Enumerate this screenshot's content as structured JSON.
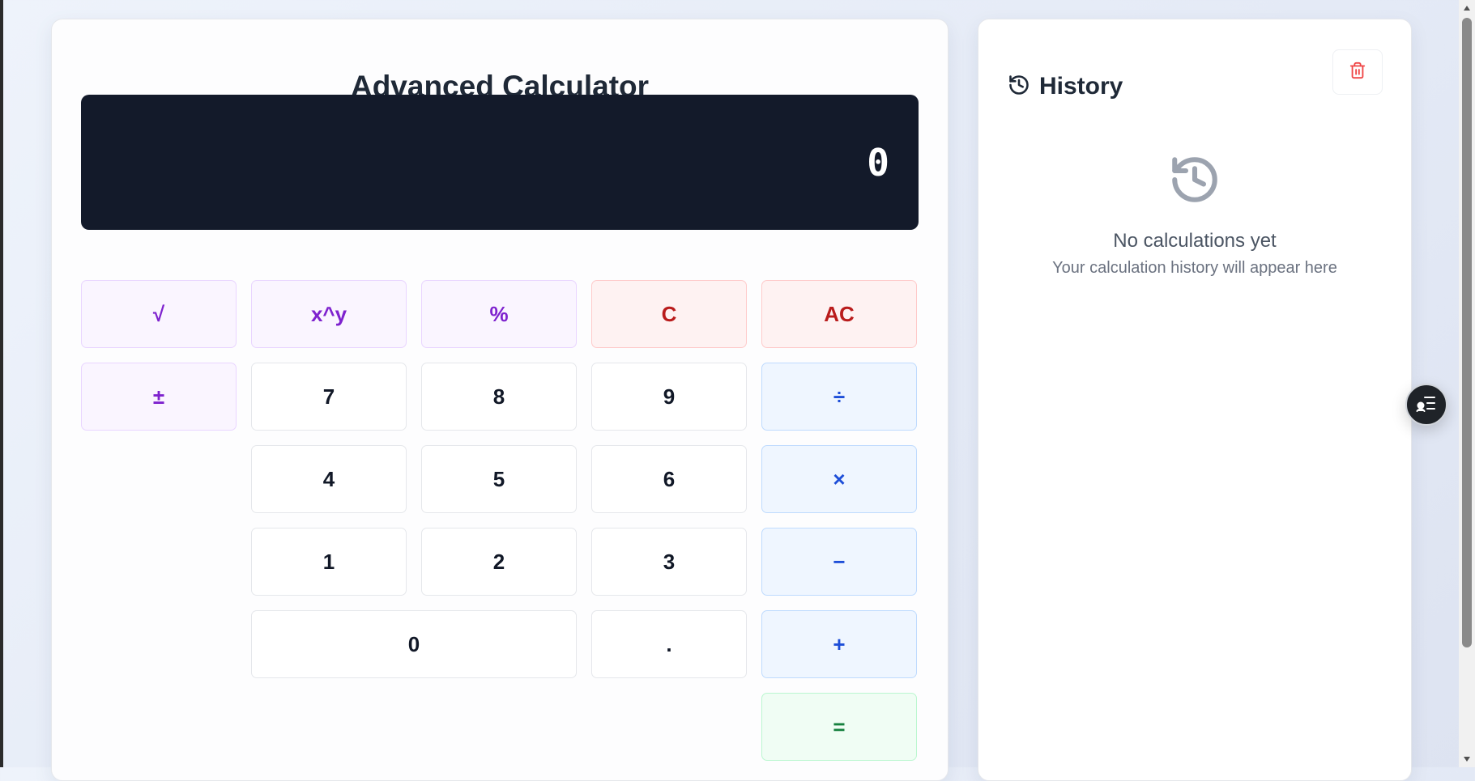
{
  "calculator": {
    "title": "Advanced Calculator",
    "display_value": "0",
    "keys": {
      "sqrt": "√",
      "power": "x^y",
      "percent": "%",
      "clear": "C",
      "all_clear": "AC",
      "negate": "±",
      "seven": "7",
      "eight": "8",
      "nine": "9",
      "divide": "÷",
      "four": "4",
      "five": "5",
      "six": "6",
      "multiply": "×",
      "one": "1",
      "two": "2",
      "three": "3",
      "subtract": "−",
      "zero": "0",
      "decimal": ".",
      "add": "+",
      "equals": "="
    }
  },
  "history": {
    "title": "History",
    "empty_title": "No calculations yet",
    "empty_subtitle": "Your calculation history will appear here"
  },
  "icons": {
    "history": "history-icon",
    "trash": "trash-icon",
    "empty_history": "history-icon",
    "fab": "list-settings-icon"
  },
  "colors": {
    "display_bg": "#131a2a",
    "function_key": "#7e22ce",
    "clear_key": "#b91c1c",
    "operator_key": "#1d4ed8",
    "equals_key": "#15803d",
    "trash_icon": "#ef4444"
  }
}
